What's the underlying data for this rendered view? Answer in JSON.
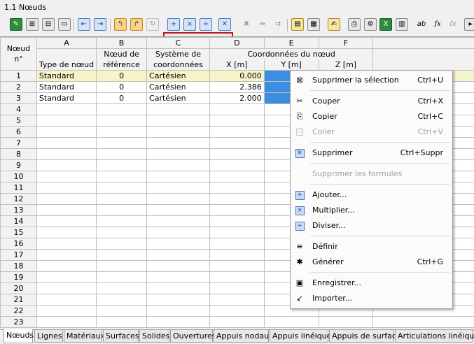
{
  "window": {
    "title": "1.1 Nœuds"
  },
  "columns": {
    "letters": [
      "A",
      "B",
      "C",
      "D",
      "E",
      "F"
    ],
    "node_header": [
      "Nœud",
      "n°"
    ],
    "col_a": "Type de nœud",
    "col_b": [
      "Nœud de",
      "référence"
    ],
    "col_c": [
      "Système de",
      "coordonnées"
    ],
    "coord_group": "Coordonnées du nœud",
    "col_d": "X [m]",
    "col_e": "Y [m]",
    "col_f": "Z [m]"
  },
  "rows": [
    {
      "n": "1",
      "type": "Standard",
      "ref": "0",
      "sys": "Cartésien",
      "x": "0.000"
    },
    {
      "n": "2",
      "type": "Standard",
      "ref": "0",
      "sys": "Cartésien",
      "x": "2.386"
    },
    {
      "n": "3",
      "type": "Standard",
      "ref": "0",
      "sys": "Cartésien",
      "x": "2.000"
    },
    {
      "n": "4"
    },
    {
      "n": "5"
    },
    {
      "n": "6"
    },
    {
      "n": "7"
    },
    {
      "n": "8"
    },
    {
      "n": "9"
    },
    {
      "n": "10"
    },
    {
      "n": "11"
    },
    {
      "n": "12"
    },
    {
      "n": "13"
    },
    {
      "n": "14"
    },
    {
      "n": "15"
    },
    {
      "n": "16"
    },
    {
      "n": "17"
    },
    {
      "n": "18"
    },
    {
      "n": "19"
    },
    {
      "n": "20"
    },
    {
      "n": "21"
    },
    {
      "n": "22"
    },
    {
      "n": "23"
    }
  ],
  "context_menu": {
    "items": [
      {
        "label": "Supprimer la sélection",
        "shortcut": "Ctrl+U",
        "icon": "delete-selection-icon",
        "disabled": false
      },
      {
        "label": "Couper",
        "shortcut": "Ctrl+X",
        "icon": "scissors-icon",
        "disabled": false
      },
      {
        "label": "Copier",
        "shortcut": "Ctrl+C",
        "icon": "copy-icon",
        "disabled": false
      },
      {
        "label": "Coller",
        "shortcut": "Ctrl+V",
        "icon": "paste-icon",
        "disabled": true
      },
      {
        "label": "Supprimer",
        "shortcut": "Ctrl+Suppr",
        "icon": "delete-icon",
        "disabled": false
      },
      {
        "label": "Supprimer les formules",
        "shortcut": "",
        "icon": "",
        "disabled": true
      },
      {
        "label": "Ajouter...",
        "shortcut": "",
        "icon": "add-icon",
        "disabled": false
      },
      {
        "label": "Multiplier...",
        "shortcut": "",
        "icon": "multiply-icon",
        "disabled": false
      },
      {
        "label": "Diviser...",
        "shortcut": "",
        "icon": "divide-icon",
        "disabled": false
      },
      {
        "label": "Définir",
        "shortcut": "",
        "icon": "define-icon",
        "disabled": false
      },
      {
        "label": "Générer",
        "shortcut": "Ctrl+G",
        "icon": "generate-icon",
        "disabled": false
      },
      {
        "label": "Enregistrer...",
        "shortcut": "",
        "icon": "save-icon",
        "disabled": false
      },
      {
        "label": "Importer...",
        "shortcut": "",
        "icon": "import-icon",
        "disabled": false
      }
    ]
  },
  "toolbar": {
    "icon_names": [
      "edit-table-icon",
      "insert-row-icon",
      "insert-column-icon",
      "delete-row-icon",
      "previous-icon",
      "next-icon",
      "filter-icon",
      "select-icon",
      "refresh-icon",
      "add-icon",
      "multiply-icon",
      "divide-icon",
      "delete-icon",
      "delete-row-grey-icon",
      "insert-grey-icon",
      "move-grey-icon",
      "table-colors-icon",
      "grid-settings-icon",
      "comment-icon",
      "print-icon",
      "settings-icon",
      "excel-export-icon",
      "calculator-icon",
      "text-format-icon",
      "function-icon",
      "function-clear-icon",
      "extra-icon"
    ]
  },
  "tabs": [
    "Nœuds",
    "Lignes",
    "Matériaux",
    "Surfaces",
    "Solides",
    "Ouvertures",
    "Appuis nodaux",
    "Appuis linéiques",
    "Appuis de surface",
    "Articulations linéiques"
  ],
  "colors": {
    "selection": "#3c8fe0",
    "row_highlight": "#f5f3c8",
    "red_outline": "#c0151c"
  }
}
